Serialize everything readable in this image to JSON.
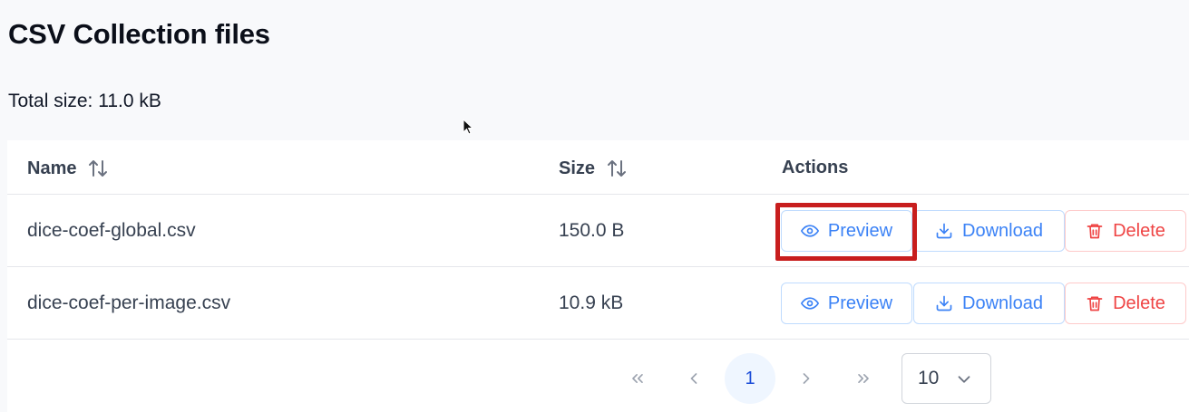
{
  "page": {
    "title": "CSV Collection files",
    "total_size": "Total size: 11.0 kB"
  },
  "table": {
    "columns": [
      "Name",
      "Size",
      "Actions"
    ],
    "rows": [
      {
        "name": "dice-coef-global.csv",
        "size": "150.0 B"
      },
      {
        "name": "dice-coef-per-image.csv",
        "size": "10.9 kB"
      }
    ],
    "actions": {
      "preview_label": "Preview",
      "download_label": "Download",
      "delete_label": "Delete"
    }
  },
  "pagination": {
    "current_page": "1",
    "rows_per_page": "10"
  },
  "colors": {
    "primary": "#3b82f6",
    "danger": "#ef4444",
    "highlight": "#c81e1e"
  }
}
